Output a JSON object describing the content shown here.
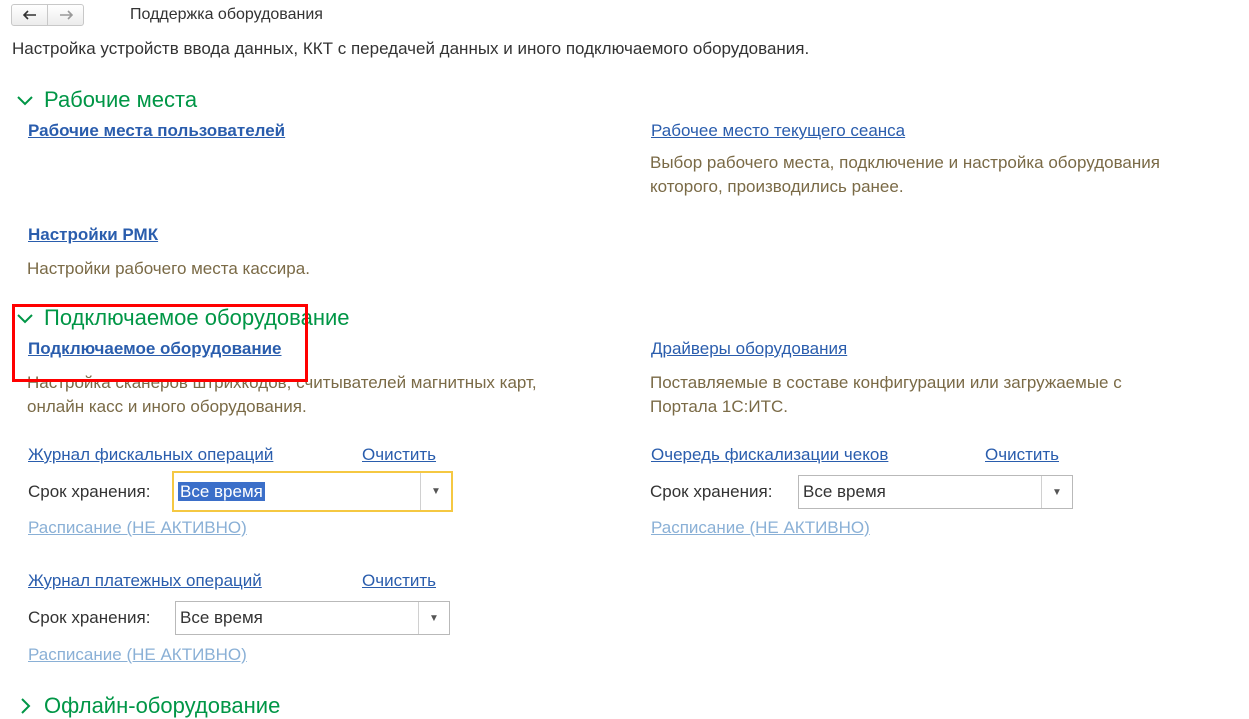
{
  "nav": {
    "back_icon": "arrow-left",
    "forward_icon": "arrow-right"
  },
  "page": {
    "title": "Поддержка оборудования",
    "subtitle": "Настройка устройств ввода данных, ККТ с передачей данных и иного подключаемого оборудования."
  },
  "sections": {
    "workplaces": {
      "header": "Рабочие места",
      "user_workplaces_link": "Рабочие места пользователей",
      "current_session_link": "Рабочее место текущего сеанса",
      "current_session_desc_1": "Выбор рабочего места, подключение и настройка оборудования",
      "current_session_desc_2": "которого, производились ранее.",
      "rmk_link": "Настройки РМК",
      "rmk_desc": "Настройки рабочего места кассира."
    },
    "connected_equipment": {
      "header": "Подключаемое оборудование",
      "equipment_link": "Подключаемое оборудование",
      "equipment_desc_1": "Настройка сканеров штрихкодов, считывателей магнитных карт,",
      "equipment_desc_2": "онлайн касс и иного оборудования.",
      "drivers_link": "Драйверы оборудования",
      "drivers_desc_1": "Поставляемые в составе конфигурации или загружаемые с",
      "drivers_desc_2": "Портала 1С:ИТС.",
      "fiscal_log": {
        "link": "Журнал фискальных операций",
        "clear": "Очистить",
        "retention_label": "Срок хранения:",
        "retention_value": "Все время",
        "schedule": "Расписание (НЕ АКТИВНО)"
      },
      "receipt_queue": {
        "link": "Очередь фискализации чеков",
        "clear": "Очистить",
        "retention_label": "Срок хранения:",
        "retention_value": "Все время",
        "schedule": "Расписание (НЕ АКТИВНО)"
      },
      "payment_log": {
        "link": "Журнал платежных операций",
        "clear": "Очистить",
        "retention_label": "Срок хранения:",
        "retention_value": "Все время",
        "schedule": "Расписание (НЕ АКТИВНО)"
      }
    },
    "offline_equipment": {
      "header": "Офлайн-оборудование"
    }
  },
  "colors": {
    "section_header": "#009646",
    "link": "#2a5dad",
    "link_disabled": "#8ab0d6",
    "description": "#7a6a46",
    "highlight": "#ff0000",
    "focus": "#f5c842",
    "selection": "#3b6fc9"
  }
}
